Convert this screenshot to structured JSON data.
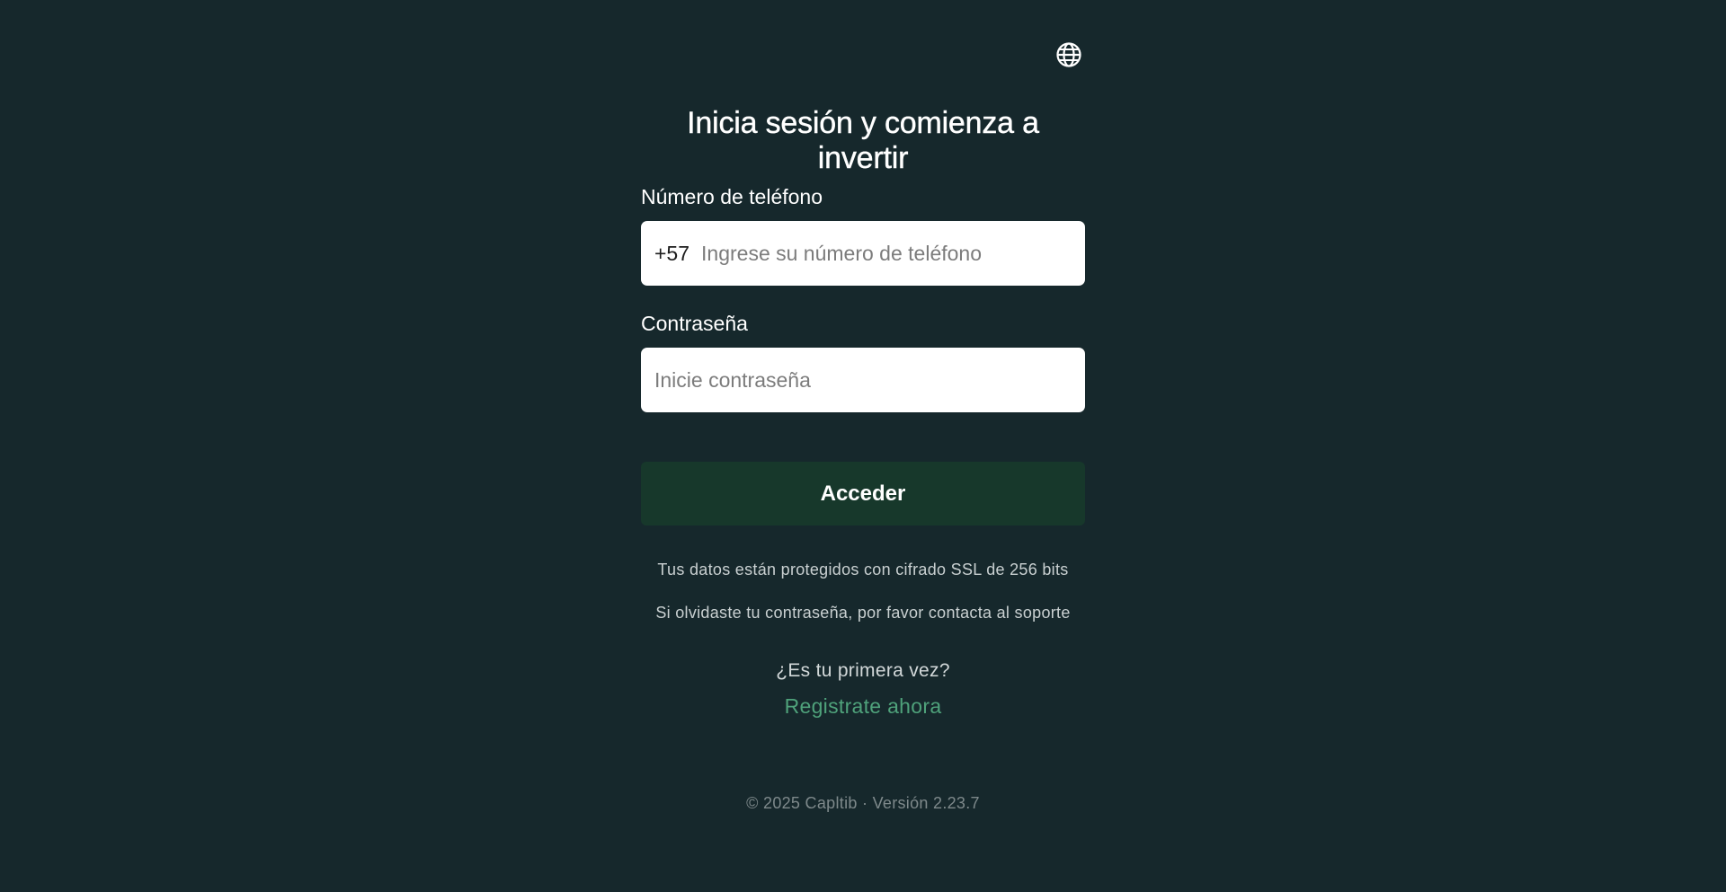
{
  "header": {
    "language_icon": "globe-icon"
  },
  "login": {
    "title": "Inicia sesión y comienza a invertir",
    "phone": {
      "label": "Número de teléfono",
      "prefix": "+57",
      "placeholder": "Ingrese su número de teléfono",
      "value": ""
    },
    "password": {
      "label": "Contraseña",
      "placeholder": "Inicie contraseña",
      "value": ""
    },
    "submit_label": "Acceder",
    "ssl_note": "Tus datos están protegidos con cifrado SSL de 256 bits",
    "forgot_note": "Si olvidaste tu contraseña, por favor contacta al soporte",
    "first_time_text": "¿Es tu primera vez?",
    "register_label": "Registrate ahora"
  },
  "footer": {
    "text": "© 2025 Capltib · Versión 2.23.7"
  },
  "colors": {
    "background": "#16282c",
    "button": "#17382b",
    "link": "#4fa27b"
  }
}
